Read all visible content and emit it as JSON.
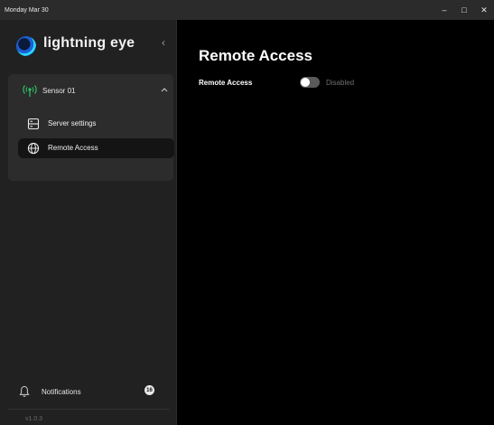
{
  "titlebar": {
    "date": "Monday Mar 30",
    "controls": {
      "minimize": "–",
      "maximize": "□",
      "close": "✕"
    }
  },
  "sidebar": {
    "brand": "lightning eye",
    "collapse_glyph": "‹",
    "sensor": {
      "label": "Sensor 01",
      "status_color": "#2ec46a",
      "items": [
        {
          "label": "Server settings",
          "icon": "server-icon",
          "active": false
        },
        {
          "label": "Remote Access",
          "icon": "globe-icon",
          "active": true
        }
      ]
    },
    "notifications": {
      "label": "Notifications",
      "count": "16"
    },
    "version": "v1.0.3"
  },
  "main": {
    "title": "Remote Access",
    "setting": {
      "label": "Remote Access",
      "enabled": false,
      "status": "Disabled"
    }
  }
}
